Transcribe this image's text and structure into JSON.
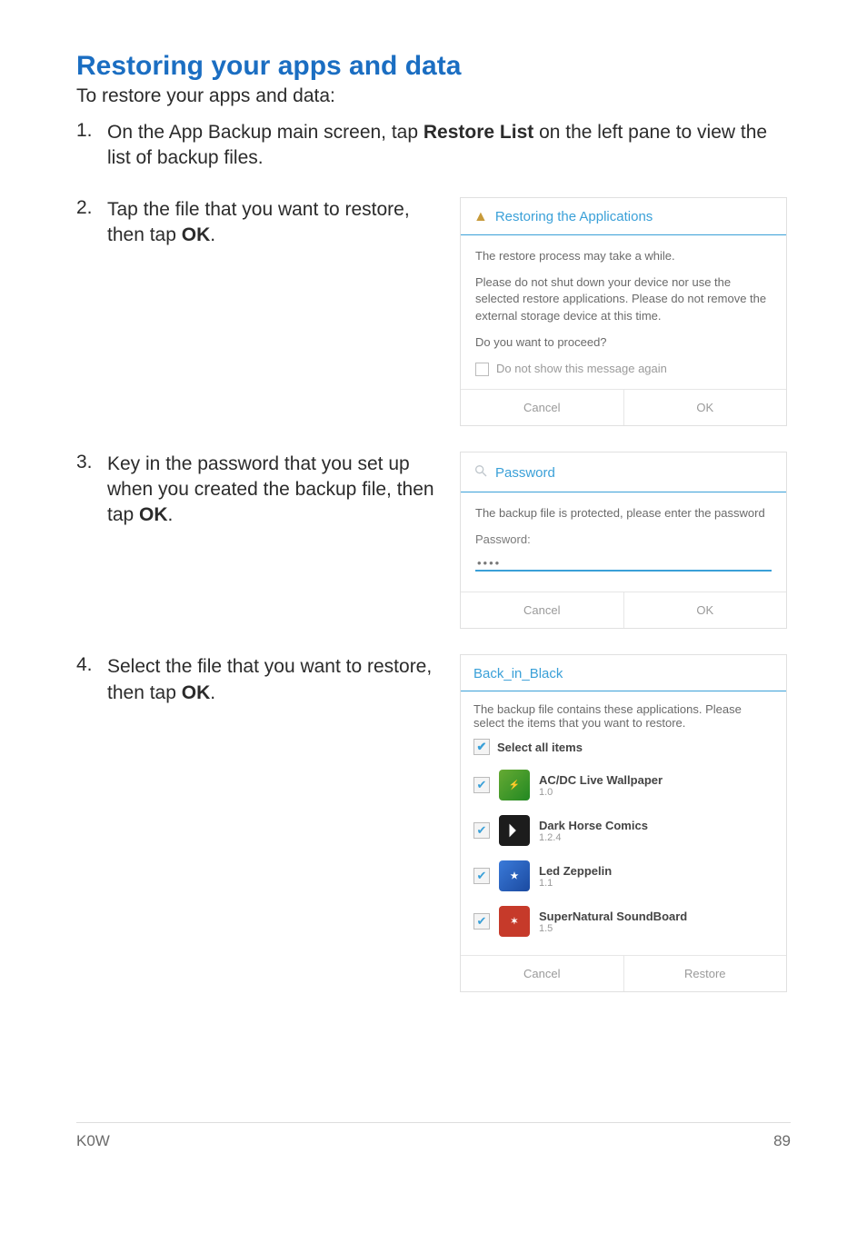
{
  "page": {
    "title": "Restoring your apps and data",
    "intro": "To restore your apps and data:",
    "footer_left": "K0W",
    "footer_right": "89"
  },
  "steps": {
    "s1_num": "1.",
    "s1_a": "On the App Backup main screen, tap ",
    "s1_b": "Restore List",
    "s1_c": " on the left pane to view the list of backup files.",
    "s2_num": "2.",
    "s2_a": "Tap the file that you want to restore, then tap ",
    "s2_b": "OK",
    "s2_c": ".",
    "s3_num": "3.",
    "s3_a": "Key in the password that you set up when you created the backup file, then tap ",
    "s3_b": "OK",
    "s3_c": ".",
    "s4_num": "4.",
    "s4_a": "Select the file that you want to restore, then tap ",
    "s4_b": "OK",
    "s4_c": "."
  },
  "dlg_restore": {
    "title": "Restoring the Applications",
    "p1": "The restore process may take a while.",
    "p2": "Please do not shut down your device nor use the selected restore applications. Please do not remove the external storage device at this time.",
    "p3": "Do you want to proceed?",
    "chk": "Do not show this message again",
    "cancel": "Cancel",
    "ok": "OK"
  },
  "dlg_pw": {
    "title": "Password",
    "msg": "The backup file is protected, please enter the password",
    "label": "Password:",
    "value": "••••",
    "cancel": "Cancel",
    "ok": "OK"
  },
  "dlg_sel": {
    "title": "Back_in_Black",
    "msg": "The backup file contains these applications. Please select the items that you want to restore.",
    "select_all": "Select all items",
    "cancel": "Cancel",
    "restore": "Restore",
    "apps": {
      "a0": {
        "name": "AC/DC Live Wallpaper",
        "ver": "1.0"
      },
      "a1": {
        "name": "Dark Horse Comics",
        "ver": "1.2.4"
      },
      "a2": {
        "name": "Led Zeppelin",
        "ver": "1.1"
      },
      "a3": {
        "name": "SuperNatural SoundBoard",
        "ver": "1.5"
      }
    }
  }
}
